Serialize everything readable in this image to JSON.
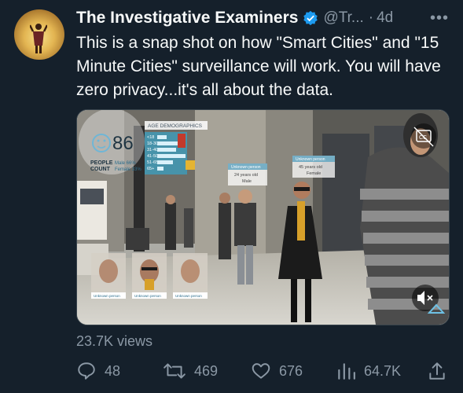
{
  "author": {
    "name": "The Investigative Examiners",
    "handle": "@Tr...",
    "separator": "·",
    "time": "4d",
    "more": "•••"
  },
  "tweet": {
    "text": "This is a snap shot on how \"Smart Cities\" and \"15 Minute Cities\" surveillance will work. You will have zero privacy...it's all about the data."
  },
  "media": {
    "panel_title": "AGE DEMOGRAPHICS",
    "people_count": "86",
    "people_label": "PEOPLE",
    "count_label": "COUNT",
    "male_pct": "Male 66%",
    "female_pct": "Female 33%",
    "age_rows": [
      "<18",
      "18-30",
      "31-40",
      "41-50",
      "51-65",
      "65+"
    ],
    "tag1_title": "Unknown person",
    "tag1_line1": "24 years old",
    "tag1_line2": "Male",
    "tag2_title": "Unknown person",
    "tag2_line1": "45 years old",
    "tag2_line2": "Female",
    "face_labels": [
      "Unknown person",
      "Unknown person",
      "Unknown person"
    ]
  },
  "stats": {
    "views": "23.7K views",
    "replies": "48",
    "retweets": "469",
    "likes": "676",
    "analytics": "64.7K"
  },
  "colors": {
    "background": "#15202b",
    "text": "#f7f9f9",
    "muted": "#8b98a5",
    "verified": "#1d9bf0"
  }
}
